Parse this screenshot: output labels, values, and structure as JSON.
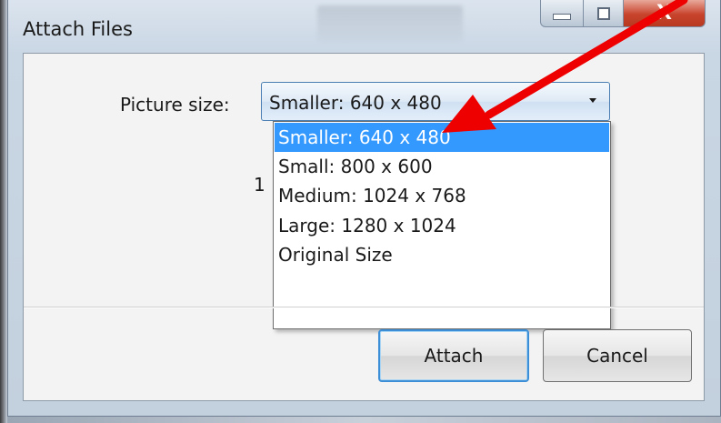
{
  "window": {
    "title": "Attach Files",
    "close_glyph": "X"
  },
  "form": {
    "picture_size_label": "Picture size:",
    "selected_value": "Smaller: 640 x 480",
    "partial_hidden_text": "1"
  },
  "dropdown": {
    "options": [
      "Smaller: 640 x 480",
      "Small: 800 x 600",
      "Medium: 1024 x 768",
      "Large: 1280 x 1024",
      "Original Size"
    ],
    "highlighted_index": 0
  },
  "buttons": {
    "attach_label": "Attach",
    "cancel_label": "Cancel"
  },
  "colors": {
    "highlight": "#3399ff",
    "annotation_arrow": "#ee0000"
  },
  "icons": {
    "dropdown": "chevron-down-icon",
    "minimize": "minimize-icon",
    "maximize": "maximize-icon",
    "close": "close-icon",
    "annotation": "red-arrow-annotation"
  }
}
